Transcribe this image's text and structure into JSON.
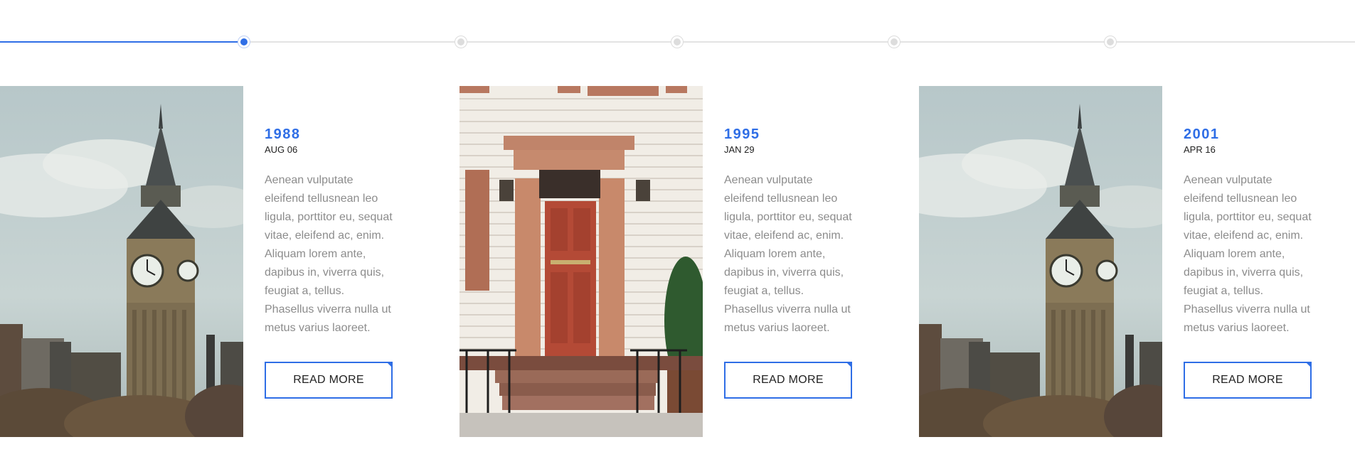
{
  "colors": {
    "accent": "#2f6ee6",
    "track": "#e3e3e3",
    "body_text": "#8c8c8c",
    "heading_text": "#222222"
  },
  "timeline": {
    "dots_count": 5,
    "active_index": 0
  },
  "cards": [
    {
      "image": "big-ben-clock-tower",
      "year": "1988",
      "date": "AUG 06",
      "text": "Aenean vulputate eleifend tellusnean leo ligula, porttitor eu, sequat vitae, eleifend ac, enim. Aliquam lorem ante, dapibus in, viverra quis, feugiat a, tellus. Phasellus viverra nulla ut metus varius laoreet.",
      "button": "READ MORE"
    },
    {
      "image": "red-front-door",
      "year": "1995",
      "date": "JAN 29",
      "text": "Aenean vulputate eleifend tellusnean leo ligula, porttitor eu, sequat vitae, eleifend ac, enim. Aliquam lorem ante, dapibus in, viverra quis, feugiat a, tellus. Phasellus viverra nulla ut metus varius laoreet.",
      "button": "READ MORE"
    },
    {
      "image": "big-ben-clock-tower",
      "year": "2001",
      "date": "APR 16",
      "text": "Aenean vulputate eleifend tellusnean leo ligula, porttitor eu, sequat vitae, eleifend ac, enim. Aliquam lorem ante, dapibus in, viverra quis, feugiat a, tellus. Phasellus viverra nulla ut metus varius laoreet.",
      "button": "READ MORE"
    }
  ]
}
